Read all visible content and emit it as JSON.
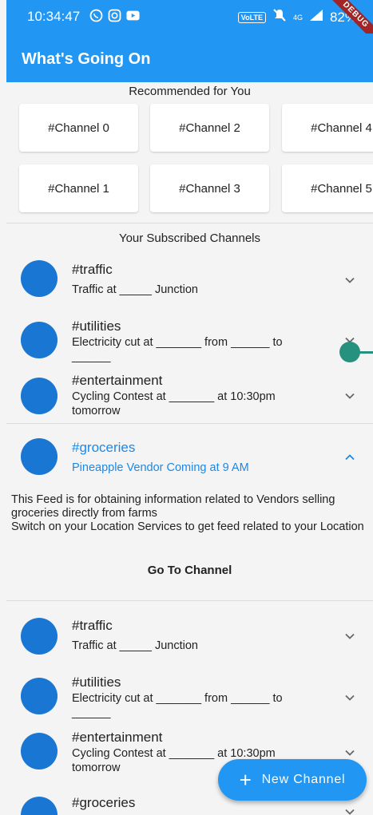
{
  "status_bar": {
    "time": "10:34:47",
    "volte": "VoLTE",
    "network": "4G",
    "battery": "82%",
    "debug_label": "DEBUG"
  },
  "app_bar": {
    "title": "What's Going On"
  },
  "recommended": {
    "title": "Recommended for You",
    "row1": [
      "#Channel 0",
      "#Channel 2",
      "#Channel 4"
    ],
    "row2": [
      "#Channel 1",
      "#Channel 3",
      "#Channel 5"
    ]
  },
  "subscribed": {
    "title": "Your Subscribed Channels",
    "items": [
      {
        "name": "#traffic",
        "desc": "Traffic at _____ Junction"
      },
      {
        "name": "#utilities",
        "desc": "Electricity cut at _______ from ______ to ______"
      },
      {
        "name": "#entertainment",
        "desc": "Cycling Contest at _______ at 10:30pm tomorrow"
      },
      {
        "name": "#groceries",
        "desc": "Pineapple Vendor Coming at 9 AM"
      }
    ],
    "expanded": {
      "description": "This Feed is for obtaining information related to Vendors selling groceries directly from farms\nSwitch on your Location Services to get feed related to your Location",
      "button": "Go To Channel"
    },
    "repeat_items": [
      {
        "name": "#traffic",
        "desc": "Traffic at _____ Junction"
      },
      {
        "name": "#utilities",
        "desc": "Electricity cut at _______ from ______ to ______"
      },
      {
        "name": "#entertainment",
        "desc": "Cycling Contest at _______ at 10:30pm tomorrow"
      },
      {
        "name": "#groceries",
        "desc": ""
      }
    ]
  },
  "fab": {
    "label": "New Channel"
  },
  "colors": {
    "primary": "#2196f3",
    "avatar": "#1976d2",
    "accent_text": "#1e88e5",
    "handle": "#26917e"
  },
  "icons": [
    "whatsapp-icon",
    "instagram-icon",
    "youtube-icon",
    "mute-icon",
    "signal-icon",
    "chevron-down-icon",
    "chevron-up-icon",
    "plus-icon"
  ]
}
